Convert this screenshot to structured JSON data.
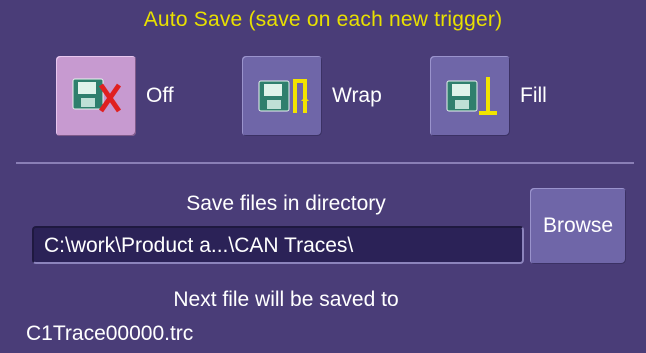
{
  "header": {
    "title": "Auto Save (save on each new trigger)"
  },
  "modes": [
    {
      "label": "Off",
      "icon": "disk-x-icon",
      "selected": true
    },
    {
      "label": "Wrap",
      "icon": "disk-wrap-icon",
      "selected": false
    },
    {
      "label": "Fill",
      "icon": "disk-fill-icon",
      "selected": false
    }
  ],
  "directory": {
    "label": "Save files in directory",
    "value": "C:\\work\\Product a...\\CAN Traces\\",
    "browse_label": "Browse"
  },
  "next_file": {
    "label": "Next file will be saved to",
    "value": "C1Trace00000.trc"
  },
  "colors": {
    "background": "#4a3d78",
    "title": "#e8e000",
    "selected": "#c79ad0",
    "button": "#6f66a8"
  }
}
